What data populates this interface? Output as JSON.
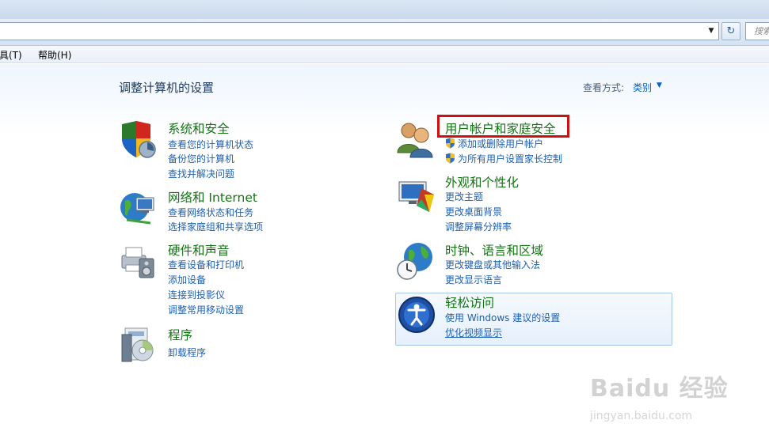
{
  "address_bar": {
    "dropdown_glyph": "▼",
    "refresh_glyph": "↻",
    "search_placeholder": "搜索"
  },
  "menu": {
    "items": [
      {
        "label": "工具(T)"
      },
      {
        "label": "帮助(H)"
      }
    ]
  },
  "header": {
    "title": "调整计算机的设置",
    "view_by_label": "查看方式:",
    "view_by_value": "类别",
    "view_by_arrow": "▼"
  },
  "categories": {
    "system_security": {
      "title": "系统和安全",
      "links": [
        "查看您的计算机状态",
        "备份您的计算机",
        "查找并解决问题"
      ]
    },
    "network_internet": {
      "title": "网络和 Internet",
      "links": [
        "查看网络状态和任务",
        "选择家庭组和共享选项"
      ]
    },
    "hardware_sound": {
      "title": "硬件和声音",
      "links": [
        "查看设备和打印机",
        "添加设备",
        "连接到投影仪",
        "调整常用移动设置"
      ]
    },
    "programs": {
      "title": "程序",
      "links": [
        "卸载程序"
      ]
    },
    "user_accounts": {
      "title": "用户帐户和家庭安全",
      "links": [
        "添加或删除用户帐户",
        "为所有用户设置家长控制"
      ]
    },
    "appearance": {
      "title": "外观和个性化",
      "links": [
        "更改主题",
        "更改桌面背景",
        "调整屏幕分辨率"
      ]
    },
    "clock_region": {
      "title": "时钟、语言和区域",
      "links": [
        "更改键盘或其他输入法",
        "更改显示语言"
      ]
    },
    "ease_of_access": {
      "title": "轻松访问",
      "links": [
        "使用 Windows 建议的设置",
        "优化视频显示"
      ]
    }
  },
  "watermark": {
    "main": "Baidu 经验",
    "sub": "jingyan.baidu.com"
  },
  "colors": {
    "category_title": "#117511",
    "link": "#1d5fb1",
    "highlight": "#cc1111"
  }
}
